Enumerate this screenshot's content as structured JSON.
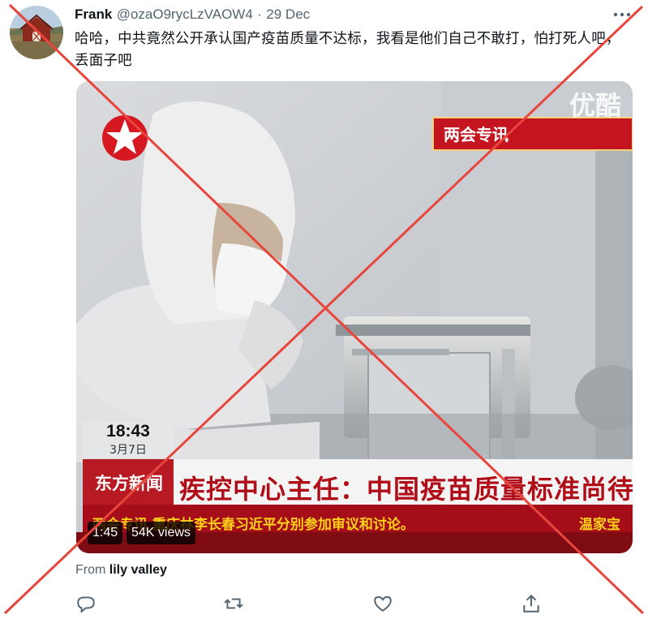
{
  "tweet": {
    "author_name": "Frank",
    "handle": "@ozaO9rycLzVAOW4",
    "separator": "·",
    "date": "29 Dec",
    "text": "哈哈，中共竟然公开承认国产疫苗质量不达标，我看是他们自己不敢打，怕打死人吧，丢面子吧",
    "source_prefix": "From",
    "source_name": "lily valley"
  },
  "video": {
    "duration": "1:45",
    "views": "54K views",
    "broadcast": {
      "top_banner": "两会专讯",
      "watermark": "优酷",
      "clock_time": "18:43",
      "clock_date": "3月7日",
      "channel_name": "东方新闻",
      "headline": "疾控中心主任：中国疫苗质量标准尚待提高",
      "scroll_text": "两会专讯 重庆林李长春习近平分别参加审议和讨论。",
      "scroll_text_right": "温家宝"
    }
  },
  "icons": {
    "avatar": "barn-landscape-avatar",
    "more": "more-options-icon",
    "reply": "reply-icon",
    "retweet": "retweet-icon",
    "like": "like-icon",
    "share": "share-icon"
  },
  "colors": {
    "cross": "#e8453c",
    "muted_text": "#536471",
    "ticker_red": "#b0101a",
    "channel_red": "#c8101e"
  }
}
